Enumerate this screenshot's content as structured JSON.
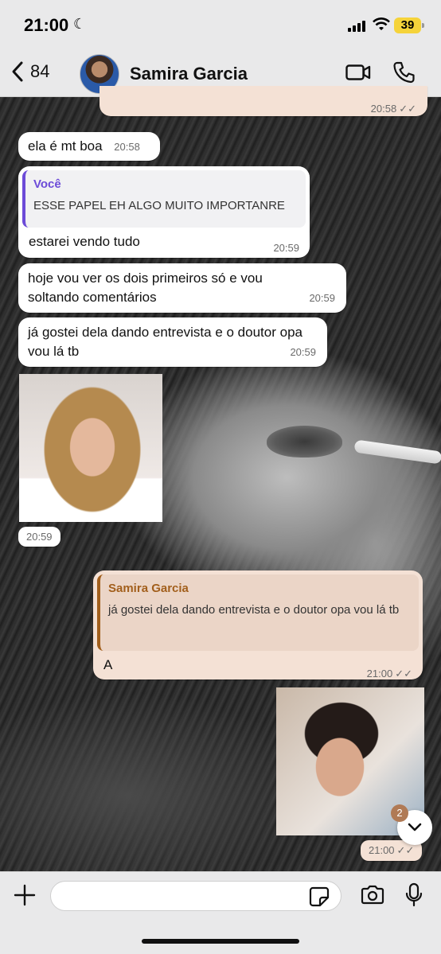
{
  "status": {
    "time": "21:00",
    "battery": "39"
  },
  "header": {
    "back_count": "84",
    "contact_name": "Samira Garcia"
  },
  "messages": [
    {
      "time": "20:58"
    },
    {
      "text": "ela é mt boa",
      "time": "20:58"
    },
    {
      "quote_author": "Você",
      "quote_text": "ESSE PAPEL EH ALGO MUITO IMPORTANRE",
      "text": "estarei vendo tudo",
      "time": "20:59"
    },
    {
      "text": "hoje vou ver os dois primeiros só e vou soltando comentários",
      "time": "20:59"
    },
    {
      "text": "já gostei dela dando entrevista e o doutor opa vou lá tb",
      "time": "20:59"
    },
    {
      "time": "20:59"
    },
    {
      "quote_author": "Samira Garcia",
      "quote_text": "já gostei dela dando entrevista e o doutor opa vou lá tb",
      "text": "A",
      "time": "21:00"
    },
    {
      "time": "21:00"
    }
  ],
  "unread_count": "2",
  "colors": {
    "header_bg": "#e9e9ea",
    "incoming_bubble": "#ffffff",
    "outgoing_bubble": "#f4e1d5",
    "quote_in_accent": "#6c4bd8",
    "quote_out_accent": "#a25f1c"
  }
}
